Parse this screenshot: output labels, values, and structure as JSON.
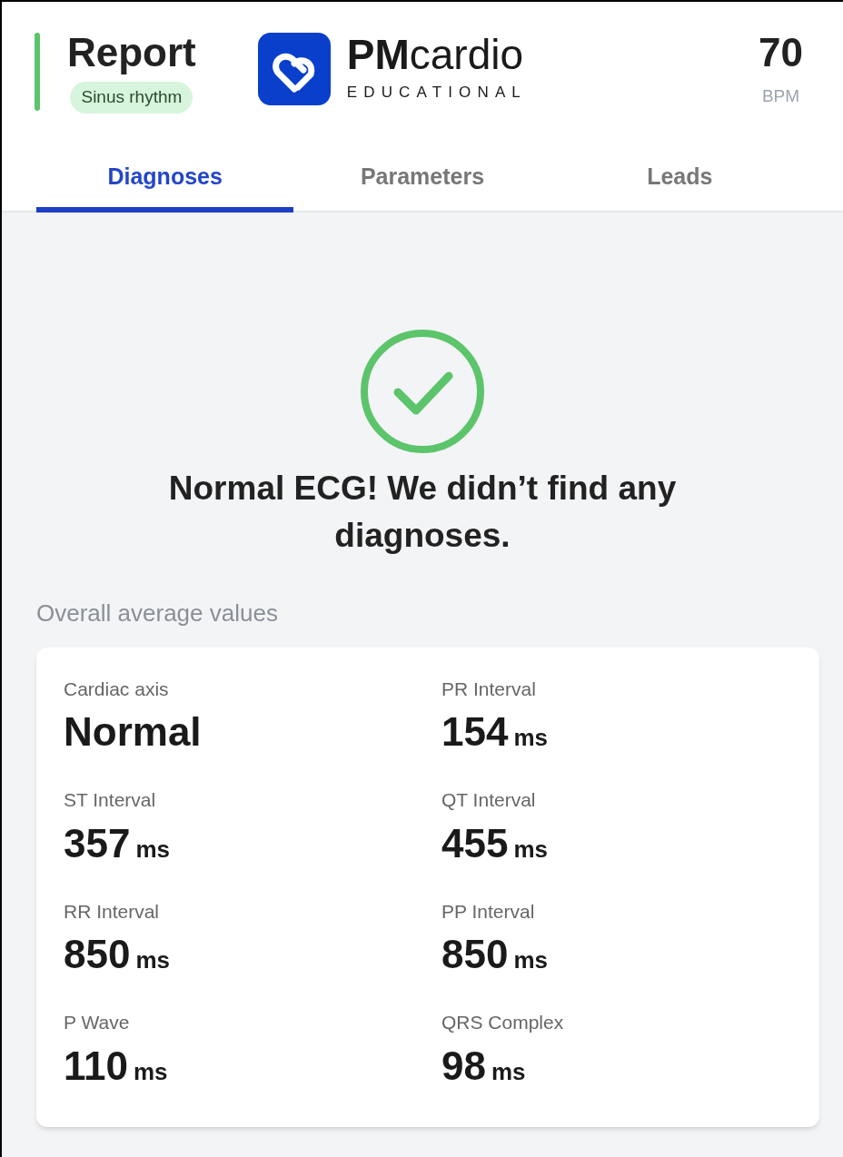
{
  "header": {
    "title": "Report",
    "rhythm_badge": "Sinus rhythm",
    "logo": {
      "name": "**PM**cardio",
      "subtitle": "EDUCATIONAL"
    },
    "heart_rate": {
      "value": "70",
      "unit": "BPM"
    }
  },
  "tabs": [
    {
      "label": "Diagnoses",
      "selected": true
    },
    {
      "label": "Parameters",
      "selected": false
    },
    {
      "label": "Leads",
      "selected": false
    }
  ],
  "result": {
    "message": "Normal ECG! We didn’t find any diagnoses."
  },
  "averages": {
    "heading": "Overall average values",
    "items": [
      {
        "label": "Cardiac axis",
        "value": "Normal"
      },
      {
        "label": "PR Interval",
        "value": "154",
        "unit": "ms"
      },
      {
        "label": "ST Interval",
        "value": "357",
        "unit": "ms"
      },
      {
        "label": "QT Interval",
        "value": "455",
        "unit": "ms"
      },
      {
        "label": "RR Interval",
        "value": "850",
        "unit": "ms"
      },
      {
        "label": "PP Interval",
        "value": "850",
        "unit": "ms"
      },
      {
        "label": "P Wave",
        "value": "110",
        "unit": "ms"
      },
      {
        "label": "QRS Complex",
        "value": "98",
        "unit": "ms"
      }
    ]
  }
}
